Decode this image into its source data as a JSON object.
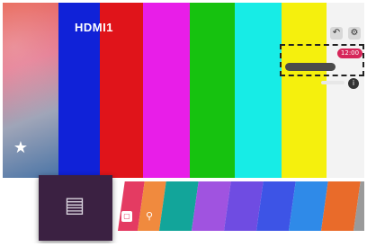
{
  "screen": {
    "input_label": "HDMI1",
    "clock": "12:00",
    "icons": {
      "home": "home-icon",
      "recent_input": "input-source-icon",
      "top_left": "back-icon",
      "top_right": "settings-icon",
      "small_row": "info-icon",
      "tile_1": "calendar-icon",
      "tile_2": "search-icon"
    }
  },
  "color_bars": [
    "#1022d8",
    "#e0141a",
    "#e81ee8",
    "#16c20f",
    "#17ece6",
    "#f5f00d",
    "#f3f3f3"
  ],
  "launcher_tiles": [
    "#e43b62",
    "#f08a3e",
    "#12a59a",
    "#a053e0",
    "#6f4ce2",
    "#3d54e6",
    "#2f8ae8",
    "#e96b2a",
    "#9a9a9a"
  ],
  "colors": {
    "accent": "#d62559",
    "panel": "#3b2142"
  }
}
